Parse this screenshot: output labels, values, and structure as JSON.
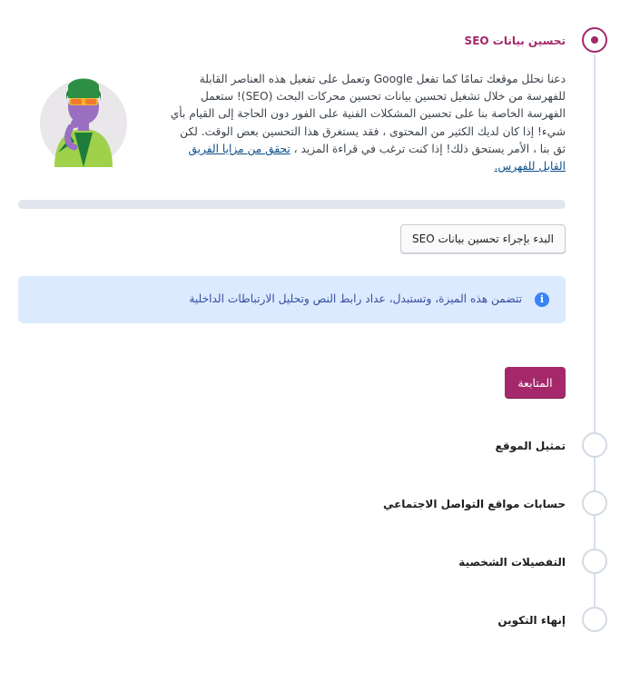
{
  "steps": [
    {
      "title": "تحسين بيانات SEO",
      "state": "active"
    },
    {
      "title": "تمثيل الموقع",
      "state": "pending"
    },
    {
      "title": "حسابات مواقع التواصل الاجتماعي",
      "state": "pending"
    },
    {
      "title": "التفصيلات الشخصية",
      "state": "pending"
    },
    {
      "title": "إنهاء التكوين",
      "state": "pending"
    }
  ],
  "seo_step": {
    "intro_text": "دعنا نحلل موقعك تمامًا كما تفعل Google وتعمل على تفعيل هذه العناصر القابلة للفهرسة من خلال تشغيل تحسين بيانات تحسين محركات البحث (SEO)! ستعمل الفهرسة الخاصة بنا على تحسين المشكلات الفنية على الفور دون الحاجة إلى القيام بأي شيء! إذا كان لديك الكثير من المحتوى ، فقد يستغرق هذا التحسين بعض الوقت. لكن ثق بنا ، الأمر يستحق ذلك! إذا كنت ترغب في قراءة المزيد ،",
    "intro_link": "تحقق من مزايا الفريق القابل للفهرس.",
    "progress": 0,
    "start_button": "البدء بإجراء تحسين بيانات SEO",
    "info_text": "تتضمن هذه الميزة، وتستبدل، عداد رابط النص وتحليل الارتباطات الداخلية",
    "info_icon": "info-icon",
    "continue_button": "المتابعة"
  },
  "colors": {
    "accent": "#a4286a",
    "info_bg": "#dbeafe",
    "info_icon": "#3b82f6",
    "stepper_line": "#d6dee8"
  }
}
